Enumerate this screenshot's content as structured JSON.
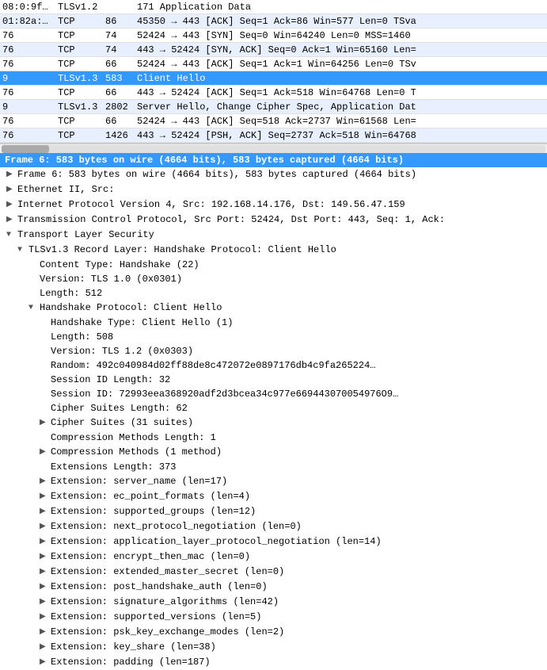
{
  "packetList": {
    "rows": [
      {
        "id": 1,
        "src": "08:0:9f…",
        "proto": "TLSv1.2",
        "len": "",
        "info": "171 Application Data",
        "style": "white"
      },
      {
        "id": 2,
        "src": "01:82a:…",
        "proto": "TCP",
        "len": "86",
        "info": "45350 → 443 [ACK] Seq=1 Ack=86 Win=577 Len=0 TSva",
        "style": "alt"
      },
      {
        "id": 3,
        "src": "76",
        "proto": "TCP",
        "len": "74",
        "info": "52424 → 443 [SYN] Seq=0 Win=64240 Len=0 MSS=1460",
        "style": "white"
      },
      {
        "id": 4,
        "src": "76",
        "proto": "TCP",
        "len": "74",
        "info": "443 → 52424 [SYN, ACK] Seq=0 Ack=1 Win=65160 Len=",
        "style": "alt"
      },
      {
        "id": 5,
        "src": "76",
        "proto": "TCP",
        "len": "66",
        "info": "52424 → 443 [ACK] Seq=1 Ack=1 Win=64256 Len=0 TSv",
        "style": "white"
      },
      {
        "id": 6,
        "src": "9",
        "proto": "TLSv1.3",
        "len": "583",
        "info": "Client Hello",
        "style": "selected"
      },
      {
        "id": 7,
        "src": "76",
        "proto": "TCP",
        "len": "66",
        "info": "443 → 52424 [ACK] Seq=1 Ack=518 Win=64768 Len=0 T",
        "style": "white"
      },
      {
        "id": 8,
        "src": "9",
        "proto": "TLSv1.3",
        "len": "2802",
        "info": "Server Hello, Change Cipher Spec, Application Dat",
        "style": "alt"
      },
      {
        "id": 9,
        "src": "76",
        "proto": "TCP",
        "len": "66",
        "info": "52424 → 443 [ACK] Seq=518 Ack=2737 Win=61568 Len=",
        "style": "white"
      },
      {
        "id": 10,
        "src": "76",
        "proto": "TCP",
        "len": "1426",
        "info": "443 → 52424 [PSH, ACK] Seq=2737 Ack=518 Win=64768",
        "style": "alt"
      }
    ]
  },
  "detailHeader": "Frame 6: 583 bytes on wire (4664 bits), 583 bytes captured (4664 bits)",
  "detailTree": [
    {
      "id": "frame",
      "indent": 1,
      "arrow": "collapsed",
      "label": "Frame 6: 583 bytes on wire (4664 bits), 583 bytes captured (4664 bits)"
    },
    {
      "id": "eth",
      "indent": 1,
      "arrow": "collapsed",
      "label": "Ethernet II, Src:"
    },
    {
      "id": "ip",
      "indent": 1,
      "arrow": "collapsed",
      "label": "Internet Protocol Version 4, Src: 192.168.14.176, Dst: 149.56.47.159"
    },
    {
      "id": "tcp",
      "indent": 1,
      "arrow": "collapsed",
      "label": "Transmission Control Protocol, Src Port: 52424, Dst Port: 443, Seq: 1, Ack:"
    },
    {
      "id": "tls",
      "indent": 1,
      "arrow": "expanded",
      "label": "Transport Layer Security"
    },
    {
      "id": "tls-record",
      "indent": 2,
      "arrow": "expanded",
      "label": "TLSv1.3 Record Layer: Handshake Protocol: Client Hello"
    },
    {
      "id": "content-type",
      "indent": 3,
      "arrow": "leaf",
      "label": "Content Type: Handshake (22)"
    },
    {
      "id": "version",
      "indent": 3,
      "arrow": "leaf",
      "label": "Version: TLS 1.0 (0x0301)"
    },
    {
      "id": "length",
      "indent": 3,
      "arrow": "leaf",
      "label": "Length: 512"
    },
    {
      "id": "handshake",
      "indent": 3,
      "arrow": "expanded",
      "label": "Handshake Protocol: Client Hello"
    },
    {
      "id": "hs-type",
      "indent": 4,
      "arrow": "leaf",
      "label": "Handshake Type: Client Hello (1)"
    },
    {
      "id": "hs-length",
      "indent": 4,
      "arrow": "leaf",
      "label": "Length: 508"
    },
    {
      "id": "hs-version",
      "indent": 4,
      "arrow": "leaf",
      "label": "Version: TLS 1.2 (0x0303)"
    },
    {
      "id": "hs-random",
      "indent": 4,
      "arrow": "leaf",
      "label": "Random: 492c040984d02ff88de8c472072e0897176db4c9fa265224…"
    },
    {
      "id": "hs-session-len",
      "indent": 4,
      "arrow": "leaf",
      "label": "Session ID Length: 32"
    },
    {
      "id": "hs-session-id",
      "indent": 4,
      "arrow": "leaf",
      "label": "Session ID: 72993eea368920adf2d3bcea34c977e669443070054976O9…"
    },
    {
      "id": "hs-cipher-len",
      "indent": 4,
      "arrow": "leaf",
      "label": "Cipher Suites Length: 62"
    },
    {
      "id": "hs-cipher-suites",
      "indent": 4,
      "arrow": "collapsed",
      "label": "Cipher Suites (31 suites)"
    },
    {
      "id": "hs-comp-len",
      "indent": 4,
      "arrow": "leaf",
      "label": "Compression Methods Length: 1"
    },
    {
      "id": "hs-comp-methods",
      "indent": 4,
      "arrow": "collapsed",
      "label": "Compression Methods (1 method)"
    },
    {
      "id": "hs-ext-len",
      "indent": 4,
      "arrow": "leaf",
      "label": "Extensions Length: 373"
    },
    {
      "id": "ext-sni",
      "indent": 4,
      "arrow": "collapsed",
      "label": "Extension: server_name (len=17)"
    },
    {
      "id": "ext-ec",
      "indent": 4,
      "arrow": "collapsed",
      "label": "Extension: ec_point_formats (len=4)"
    },
    {
      "id": "ext-groups",
      "indent": 4,
      "arrow": "collapsed",
      "label": "Extension: supported_groups (len=12)"
    },
    {
      "id": "ext-npn",
      "indent": 4,
      "arrow": "collapsed",
      "label": "Extension: next_protocol_negotiation (len=0)"
    },
    {
      "id": "ext-alpn",
      "indent": 4,
      "arrow": "collapsed",
      "label": "Extension: application_layer_protocol_negotiation (len=14)"
    },
    {
      "id": "ext-etm",
      "indent": 4,
      "arrow": "collapsed",
      "label": "Extension: encrypt_then_mac (len=0)"
    },
    {
      "id": "ext-ems",
      "indent": 4,
      "arrow": "collapsed",
      "label": "Extension: extended_master_secret (len=0)"
    },
    {
      "id": "ext-pha",
      "indent": 4,
      "arrow": "collapsed",
      "label": "Extension: post_handshake_auth (len=0)"
    },
    {
      "id": "ext-sigalg",
      "indent": 4,
      "arrow": "collapsed",
      "label": "Extension: signature_algorithms (len=42)"
    },
    {
      "id": "ext-sv",
      "indent": 4,
      "arrow": "collapsed",
      "label": "Extension: supported_versions (len=5)"
    },
    {
      "id": "ext-psk",
      "indent": 4,
      "arrow": "collapsed",
      "label": "Extension: psk_key_exchange_modes (len=2)"
    },
    {
      "id": "ext-ks",
      "indent": 4,
      "arrow": "collapsed",
      "label": "Extension: key_share (len=38)"
    },
    {
      "id": "ext-pad",
      "indent": 4,
      "arrow": "collapsed",
      "label": "Extension: padding (len=187)"
    }
  ]
}
